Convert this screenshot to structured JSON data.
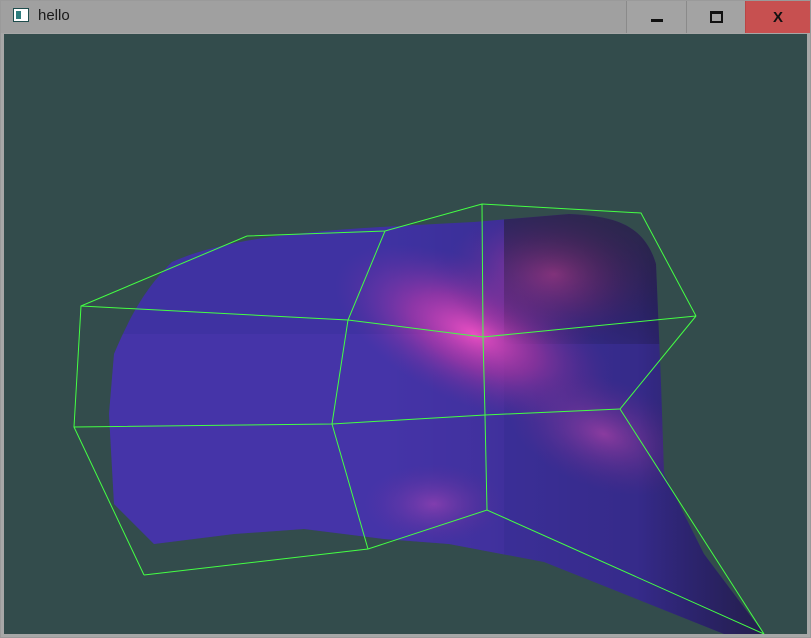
{
  "window": {
    "title": "hello",
    "icon": "app-window-icon",
    "controls": {
      "minimize": "minimize-icon",
      "maximize": "maximize-icon",
      "close_glyph": "X"
    }
  },
  "scene": {
    "background_color": "#334c4c",
    "surface_base_color": "#3d2f9e",
    "highlight_color": "#ff4fc0",
    "wireframe_color": "#44ff44",
    "wireframe_description_rows": 3,
    "wireframe_description_cols": 4
  }
}
